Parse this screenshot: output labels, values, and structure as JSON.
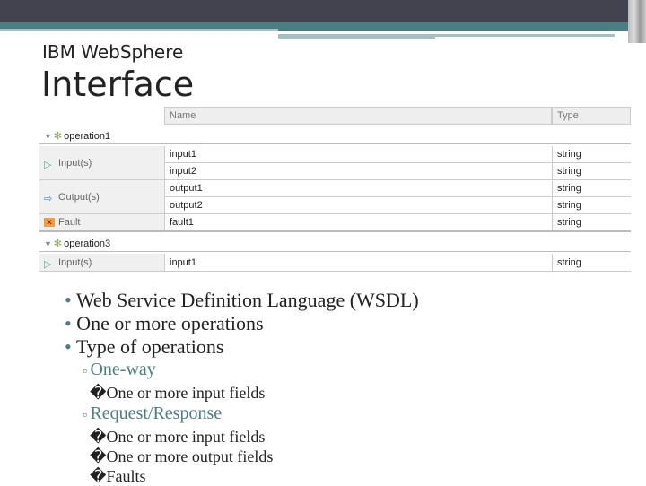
{
  "header": {
    "subtitle": "IBM WebSphere",
    "title": "Interface"
  },
  "table": {
    "columns": [
      "Name",
      "Type"
    ],
    "operations": [
      {
        "name": "operation1",
        "groups": [
          {
            "label": "Input(s)",
            "icon": "input-arrow-icon",
            "rows": [
              {
                "name": "input1",
                "type": "string"
              },
              {
                "name": "input2",
                "type": "string"
              }
            ]
          },
          {
            "label": "Output(s)",
            "icon": "output-arrow-icon",
            "rows": [
              {
                "name": "output1",
                "type": "string"
              },
              {
                "name": "output2",
                "type": "string"
              }
            ]
          },
          {
            "label": "Fault",
            "icon": "fault-icon",
            "rows": [
              {
                "name": "fault1",
                "type": "string"
              }
            ]
          }
        ]
      },
      {
        "name": "operation3",
        "groups": [
          {
            "label": "Input(s)",
            "icon": "input-arrow-icon",
            "rows": [
              {
                "name": "input1",
                "type": "string"
              }
            ]
          }
        ]
      }
    ]
  },
  "bullets": {
    "b1": "Web Service Definition Language (WSDL)",
    "b2": "One or more operations",
    "b3": "Type of operations",
    "oneway": "One-way",
    "oneway_items": [
      "�One or more input fields"
    ],
    "reqresp": "Request/Response",
    "reqresp_items": [
      "�One or more input fields",
      "�One or more output fields",
      "�Faults"
    ]
  }
}
